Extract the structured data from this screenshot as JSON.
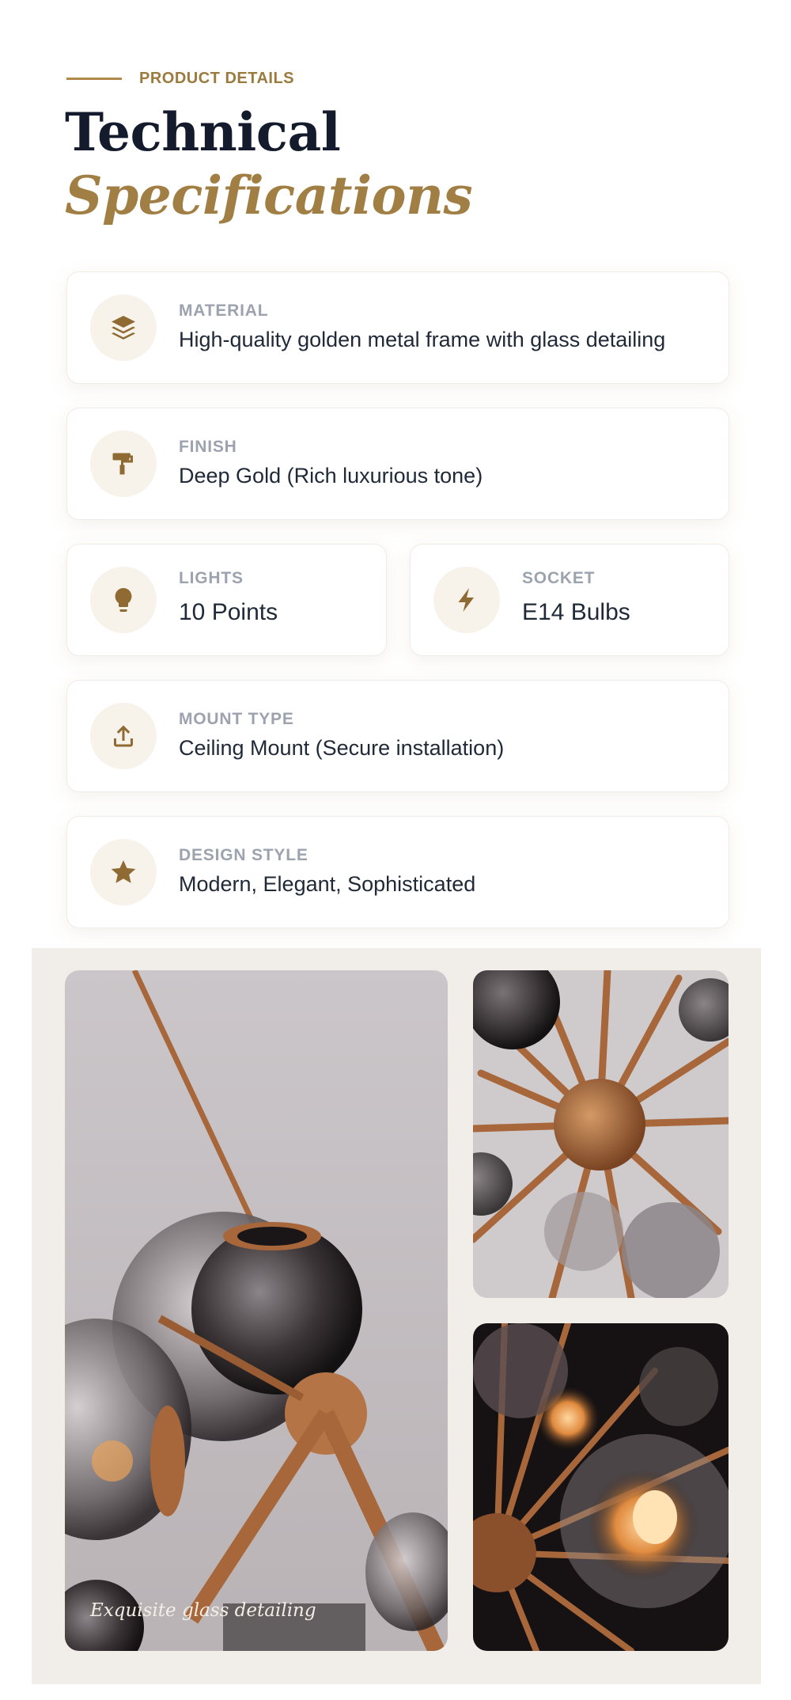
{
  "header": {
    "eyebrow": "PRODUCT DETAILS",
    "title_line1": "Technical",
    "title_line2": "Specifications"
  },
  "specs": [
    {
      "label": "MATERIAL",
      "value": "High-quality golden metal frame with glass detailing",
      "icon": "layers-icon"
    },
    {
      "label": "FINISH",
      "value": "Deep Gold (Rich luxurious tone)",
      "icon": "paint-roller-icon"
    },
    {
      "label": "LIGHTS",
      "value": "10 Points",
      "icon": "lightbulb-icon"
    },
    {
      "label": "SOCKET",
      "value": "E14 Bulbs",
      "icon": "bolt-icon"
    },
    {
      "label": "MOUNT TYPE",
      "value": "Ceiling Mount (Secure installation)",
      "icon": "upload-icon"
    },
    {
      "label": "DESIGN STYLE",
      "value": "Modern, Elegant, Sophisticated",
      "icon": "star-icon"
    }
  ],
  "gallery": {
    "caption": "Exquisite glass detailing"
  },
  "colors": {
    "accent_gold": "#a17f44",
    "heading_navy": "#141b2d",
    "icon_bg": "#f7f2ea"
  }
}
